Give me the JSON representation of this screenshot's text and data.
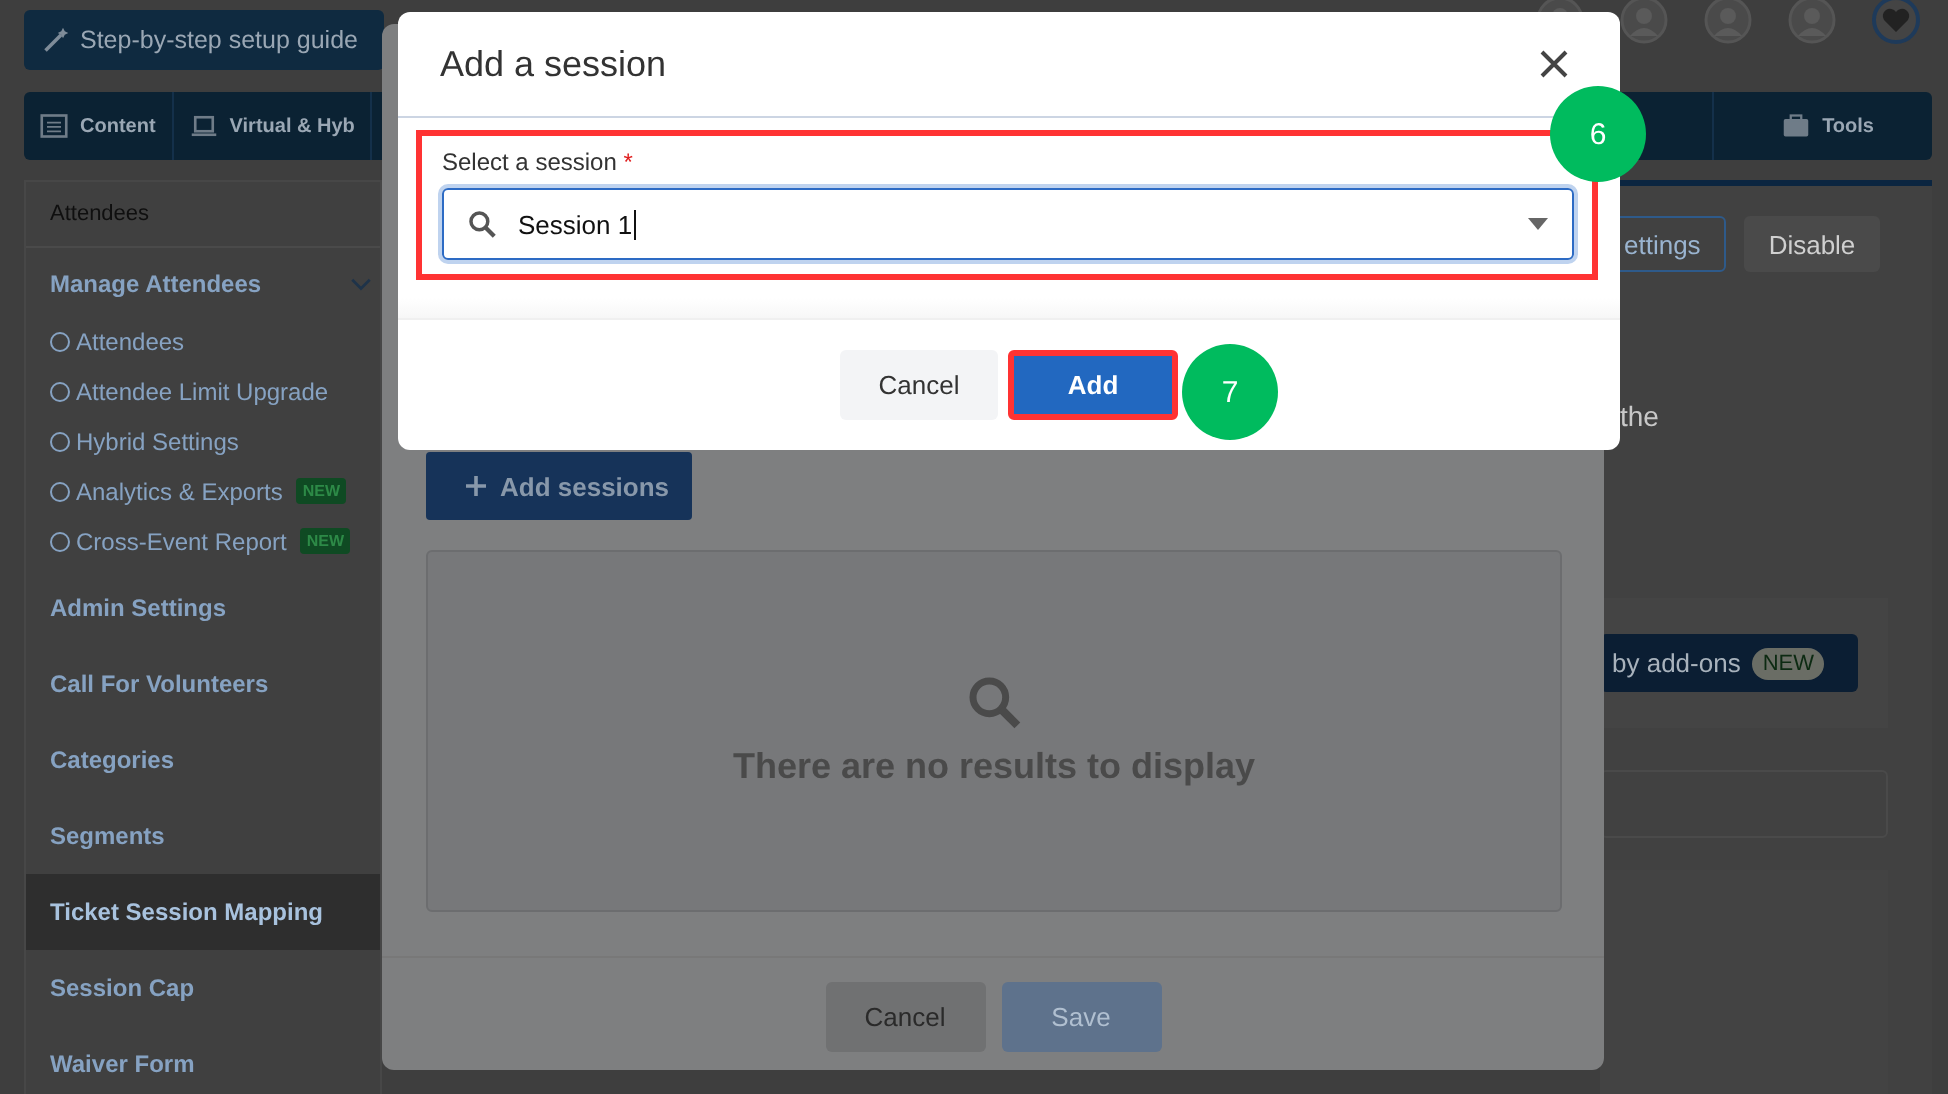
{
  "setup_guide_button": "Step-by-step setup guide",
  "nav_tabs": [
    {
      "label": "Content"
    },
    {
      "label": "Virtual & Hyb"
    }
  ],
  "nav_tabs_right": [
    {
      "label": "Tools"
    }
  ],
  "sidebar": {
    "heading": "Attendees",
    "group": {
      "label": "Manage Attendees",
      "expanded": true,
      "children": [
        {
          "label": "Attendees"
        },
        {
          "label": "Attendee Limit Upgrade"
        },
        {
          "label": "Hybrid Settings"
        },
        {
          "label": "Analytics & Exports",
          "badge": "NEW"
        },
        {
          "label": "Cross-Event Report",
          "badge": "NEW"
        }
      ]
    },
    "items": [
      {
        "label": "Admin Settings",
        "selected": false
      },
      {
        "label": "Call For Volunteers",
        "selected": false
      },
      {
        "label": "Categories",
        "selected": false
      },
      {
        "label": "Segments",
        "selected": false
      },
      {
        "label": "Ticket Session Mapping",
        "selected": true
      },
      {
        "label": "Session Cap",
        "selected": false
      },
      {
        "label": "Waiver Form",
        "selected": false
      }
    ]
  },
  "right_panel": {
    "buttons": [
      {
        "label": "ettings",
        "kind": "outline"
      },
      {
        "label": "Disable",
        "kind": "plain"
      }
    ],
    "text_fragment": "the",
    "addons_button": {
      "label": "by add-ons",
      "badge": "NEW"
    }
  },
  "sessions_modal": {
    "add_button": "Add sessions",
    "empty_text": "There are no results to display",
    "buttons": [
      {
        "label": "Cancel",
        "disabled": false
      },
      {
        "label": "Save",
        "disabled": true
      }
    ]
  },
  "dialog": {
    "title": "Add a session",
    "field_highlighted": true,
    "field": {
      "label": "Select a session",
      "required_mark": "*",
      "value": "Session 1"
    },
    "buttons": [
      {
        "label": "Cancel",
        "kind": "secondary",
        "highlighted": false
      },
      {
        "label": "Add",
        "kind": "primary",
        "highlighted": true
      }
    ]
  },
  "step_markers": [
    {
      "label": "6"
    },
    {
      "label": "7"
    }
  ]
}
